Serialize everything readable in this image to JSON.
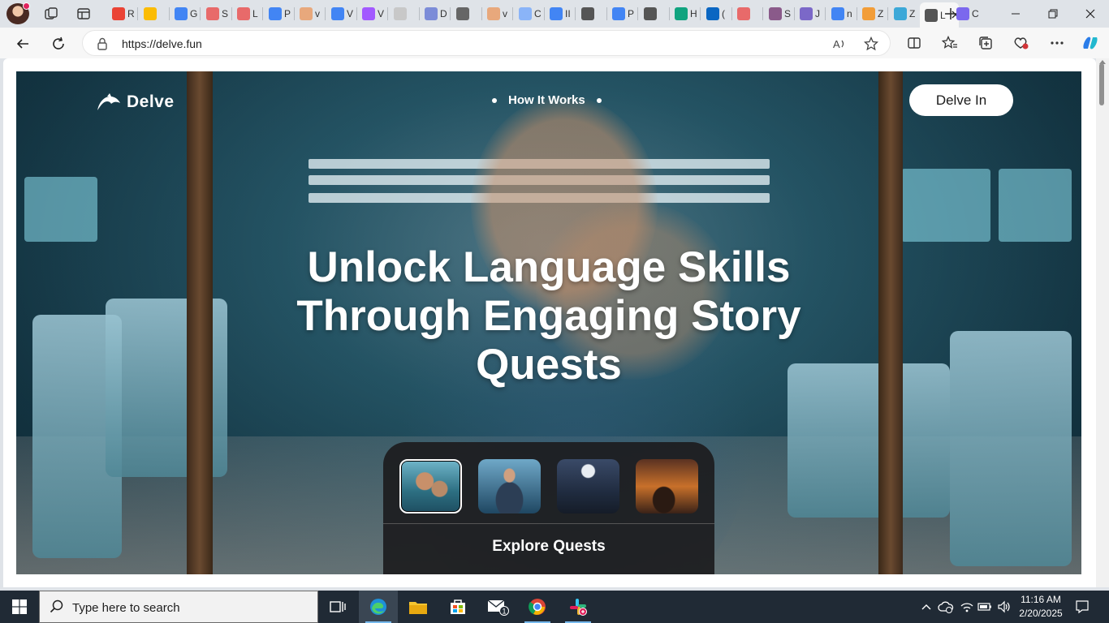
{
  "browser": {
    "tabs": [
      {
        "label": "R",
        "icon": "gmail-icon",
        "color": "#ea4335"
      },
      {
        "label": "",
        "icon": "google-photos-icon",
        "color": "#fbbc04"
      },
      {
        "label": "G",
        "icon": "google-icon",
        "color": "#4285f4"
      },
      {
        "label": "S",
        "icon": "dots-icon",
        "color": "#e86a6a"
      },
      {
        "label": "L",
        "icon": "dots-icon",
        "color": "#e86a6a"
      },
      {
        "label": "P",
        "icon": "docs-icon",
        "color": "#4285f4"
      },
      {
        "label": "v",
        "icon": "image-icon",
        "color": "#e8a87c"
      },
      {
        "label": "V",
        "icon": "docs-icon",
        "color": "#4285f4"
      },
      {
        "label": "V",
        "icon": "figma-icon",
        "color": "#a259ff"
      },
      {
        "label": "",
        "icon": "blank-doc-icon",
        "color": "#c8c8c8"
      },
      {
        "label": "D",
        "icon": "cloud-icon",
        "color": "#7c8cd8"
      },
      {
        "label": "",
        "icon": "disc-icon",
        "color": "#666666"
      },
      {
        "label": "v",
        "icon": "image-icon",
        "color": "#e8a87c"
      },
      {
        "label": "C",
        "icon": "docs-icon",
        "color": "#8ab4f8"
      },
      {
        "label": "II",
        "icon": "docs-icon",
        "color": "#4285f4"
      },
      {
        "label": "",
        "icon": "vercel-icon",
        "color": "#555555"
      },
      {
        "label": "P",
        "icon": "docs-icon",
        "color": "#4285f4"
      },
      {
        "label": "",
        "icon": "vercel-icon",
        "color": "#555555"
      },
      {
        "label": "H",
        "icon": "openai-icon",
        "color": "#10a37f"
      },
      {
        "label": "(",
        "icon": "linkedin-icon",
        "color": "#0a66c2"
      },
      {
        "label": "",
        "icon": "dots-icon",
        "color": "#e86a6a"
      },
      {
        "label": "S",
        "icon": "bird-icon",
        "color": "#8a5a8a"
      },
      {
        "label": "J",
        "icon": "list-icon",
        "color": "#7b68c8"
      },
      {
        "label": "n",
        "icon": "search-icon",
        "color": "#4285f4"
      },
      {
        "label": "Z",
        "icon": "copilot-icon",
        "color": "#f29d38"
      },
      {
        "label": "Z",
        "icon": "copilot-icon",
        "color": "#3ca8d8"
      },
      {
        "label": "L",
        "icon": "delve-icon",
        "color": "#555555",
        "active": true
      },
      {
        "label": "C",
        "icon": "clickup-icon",
        "color": "#7b68ee"
      }
    ],
    "url": "https://delve.fun"
  },
  "page": {
    "logo": "Delve",
    "nav_link": "How It Works",
    "cta": "Delve In",
    "headline": "Unlock Language Skills Through Engaging Story Quests",
    "explore": "Explore Quests"
  },
  "taskbar": {
    "search_placeholder": "Type here to search",
    "mail_badge": "1",
    "time": "11:16 AM",
    "date": "2/20/2025"
  },
  "colors": {
    "accent": "#1a73e8",
    "hero_overlay": "#173f4e",
    "panel": "#1c1c1e"
  }
}
